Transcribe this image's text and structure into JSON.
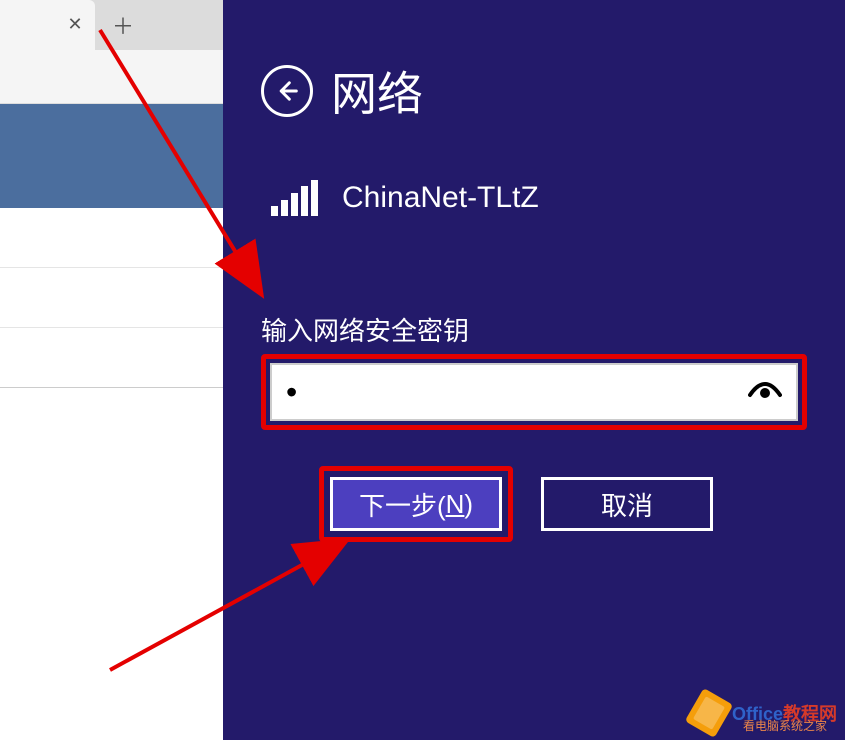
{
  "panel": {
    "title": "网络",
    "network_name": "ChinaNet-TLtZ",
    "password_label": "输入网络安全密钥",
    "password_value": "•",
    "next_label_prefix": "下一步(",
    "next_label_underline": "N",
    "next_label_suffix": ")",
    "cancel_label": "取消"
  },
  "watermark": {
    "brand1": "Office",
    "brand2": "教程网",
    "sub": "看电脑系统之家"
  },
  "colors": {
    "panel_bg": "#231a6a",
    "highlight": "#e40000",
    "primary_btn": "#4c3fbf"
  }
}
